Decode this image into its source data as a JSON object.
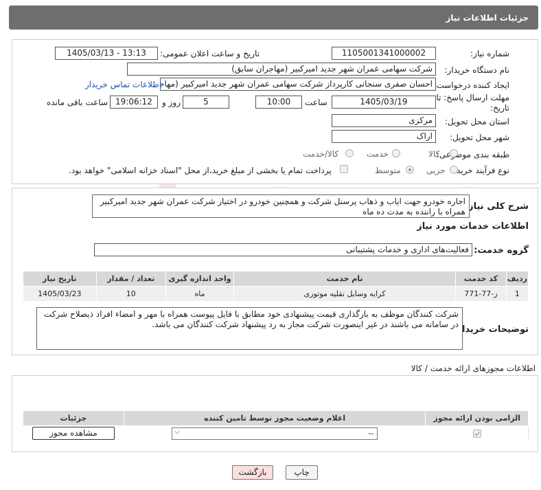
{
  "header": {
    "title": "جزئیات اطلاعات نیاز"
  },
  "form": {
    "need_number_label": "شماره نیاز:",
    "need_number": "1105001341000002",
    "announce_label": "تاریخ و ساعت اعلان عمومی:",
    "announce_value": "1405/03/13 - 13:13",
    "buyer_org_label": "نام دستگاه خریدار:",
    "buyer_org": "شرکت سهامی عمران شهر جدید امیرکبیر (مهاجران سابق)",
    "creator_label": "ایجاد کننده درخواست:",
    "creator": "احسان صفری سنجانی کارپرداز شرکت سهامی عمران شهر جدید امیرکبیر (مهاجران سابق)",
    "contact_link": "اطلاعات تماس خریدار",
    "deadline_label_1": "مهلت ارسال پاسخ: تا",
    "deadline_label_2": "تاریخ:",
    "deadline_date": "1405/03/19",
    "time_label": "ساعت",
    "deadline_time": "10:00",
    "days_value": "5",
    "days_label": "روز و",
    "remaining_time": "19:06:12",
    "remaining_label": "ساعت باقی مانده",
    "province_label": "استان محل تحویل:",
    "province": "مرکزی",
    "city_label": "شهر محل تحویل:",
    "city": "اراک",
    "category_label": "طبقه بندی موضوعی:",
    "category_options": [
      "کالا",
      "خدمت",
      "کالا/خدمت"
    ],
    "process_label": "نوع فرآیند خرید :",
    "process_options": [
      "جزیی",
      "متوسط"
    ],
    "payment_note": "پرداخت تمام یا بخشی از مبلغ خرید،از محل \"اسناد خزانه اسلامی\" خواهد بود."
  },
  "summary": {
    "label": "شرح کلی نیاز:",
    "text": "اجاره خودرو جهت ایاب و ذهاب پرسنل شرکت و همچنین خودرو در اختیار شرکت عمران شهر جدید امیرکبیر همراه با راننده به مدت ده ماه"
  },
  "services": {
    "title": "اطلاعات خدمات مورد نیاز",
    "group_label": "گروه خدمت:",
    "group_value": "فعالیت‌های اداری و خدمات پشتیبانی",
    "columns": [
      "ردیف",
      "کد خدمت",
      "نام خدمت",
      "واحد اندازه گیری",
      "تعداد / مقدار",
      "تاریخ نیاز"
    ],
    "rows": [
      [
        "1",
        "ز-77-771",
        "کرایه وسایل نقلیه موتوری",
        "ماه",
        "10",
        "1405/03/23"
      ]
    ]
  },
  "buyer_notes": {
    "label": "توضیحات خریدار:",
    "text": "شرکت کنندگان موظف به بارگذاری قیمت پیشنهادی خود مطابق با فایل پیوست همراه با مهر و امضاء افراد ذیصلاح شرکت در سامانه می باشند در غیر اینصورت شرکت مجاز به رد پیشنهاد شرکت کنندگان می باشد."
  },
  "permits": {
    "title": "اطلاعات مجوزهای ارائه خدمت / کالا",
    "columns": [
      "الزامی بودن ارائه مجوز",
      "اعلام وضعیت مجوز توسط تامین کننده",
      "جزئیات"
    ],
    "status_select": "--",
    "view_button": "مشاهده مجوز"
  },
  "actions": {
    "print": "چاپ",
    "back": "بازگشت"
  },
  "watermark": {
    "text": "AriaTender.neT"
  }
}
